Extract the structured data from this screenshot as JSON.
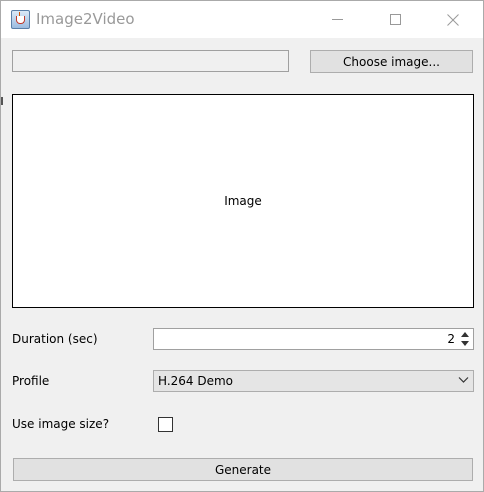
{
  "window": {
    "title": "Image2Video",
    "icon": "java-cup-icon"
  },
  "file": {
    "path_value": "",
    "choose_label": "Choose image..."
  },
  "preview": {
    "placeholder": "Image"
  },
  "form": {
    "duration_label": "Duration (sec)",
    "duration_value": "2",
    "profile_label": "Profile",
    "profile_value": "H.264 Demo",
    "use_size_label": "Use image size?",
    "use_size_checked": false
  },
  "actions": {
    "generate_label": "Generate"
  }
}
